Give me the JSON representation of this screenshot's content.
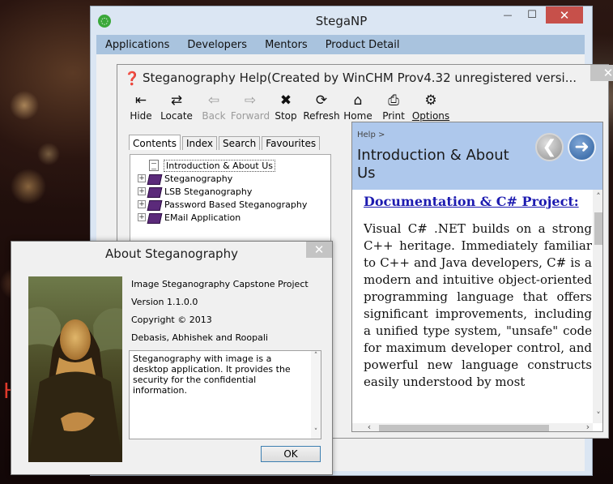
{
  "main_window": {
    "title": "StegaNP",
    "menu": [
      "Applications",
      "Developers",
      "Mentors",
      "Product Detail"
    ],
    "close_glyph": "✕",
    "minimize_glyph": "—",
    "maximize_glyph": "☐"
  },
  "help_window": {
    "title": "Steganography Help(Created by WinCHM Prov4.32 unregistered versi...",
    "close_glyph": "✕",
    "toolbar": [
      {
        "label": "Hide",
        "icon": "hide-icon",
        "glyph": "⇤",
        "enabled": true
      },
      {
        "label": "Locate",
        "icon": "locate-icon",
        "glyph": "⇄",
        "enabled": true
      },
      {
        "label": "Back",
        "icon": "back-arrow-icon",
        "glyph": "⇦",
        "enabled": false
      },
      {
        "label": "Forward",
        "icon": "forward-arrow-icon",
        "glyph": "⇨",
        "enabled": false
      },
      {
        "label": "Stop",
        "icon": "stop-icon",
        "glyph": "✖",
        "enabled": true
      },
      {
        "label": "Refresh",
        "icon": "refresh-icon",
        "glyph": "⟳",
        "enabled": true
      },
      {
        "label": "Home",
        "icon": "home-icon",
        "glyph": "⌂",
        "enabled": true
      },
      {
        "label": "Print",
        "icon": "print-icon",
        "glyph": "⎙",
        "enabled": true
      },
      {
        "label": "Options",
        "icon": "options-icon",
        "glyph": "⚙",
        "enabled": true
      }
    ],
    "tabs": [
      "Contents",
      "Index",
      "Search",
      "Favourites"
    ],
    "active_tab": "Contents",
    "tree": [
      {
        "label": "Introduction & About Us",
        "type": "page",
        "selected": true
      },
      {
        "label": "Steganography",
        "type": "book",
        "selected": false
      },
      {
        "label": "LSB Steganography",
        "type": "book",
        "selected": false
      },
      {
        "label": "Password Based Steganography",
        "type": "book",
        "selected": false
      },
      {
        "label": "EMail Application",
        "type": "book",
        "selected": false
      }
    ],
    "content": {
      "breadcrumb": "Help >",
      "topic_title": "Introduction & About Us",
      "heading": "Documentation & C# Project:",
      "body": "Visual C# .NET builds on a strong C++ heritage. Immediately familiar to C++ and Java developers, C# is a modern and intuitive object-oriented programming language that offers significant improvements, including a unified type system, \"unsafe\" code for maximum developer control, and powerful new language constructs easily understood by most"
    }
  },
  "about_dialog": {
    "title": "About Steganography",
    "close_glyph": "✕",
    "product": "Image Steganography Capstone Project",
    "version": "Version 1.1.0.0",
    "copyright": "Copyright ©  2013",
    "authors": "Debasis, Abhishek and Roopali",
    "description": "Steganography with image is a desktop application. It provides the security for the confidential information.",
    "ok_label": "OK"
  },
  "colors": {
    "menubar": "#a9c3de",
    "content_header": "#aec8ec",
    "link": "#1d1bb0",
    "close_red": "#c7504a"
  }
}
